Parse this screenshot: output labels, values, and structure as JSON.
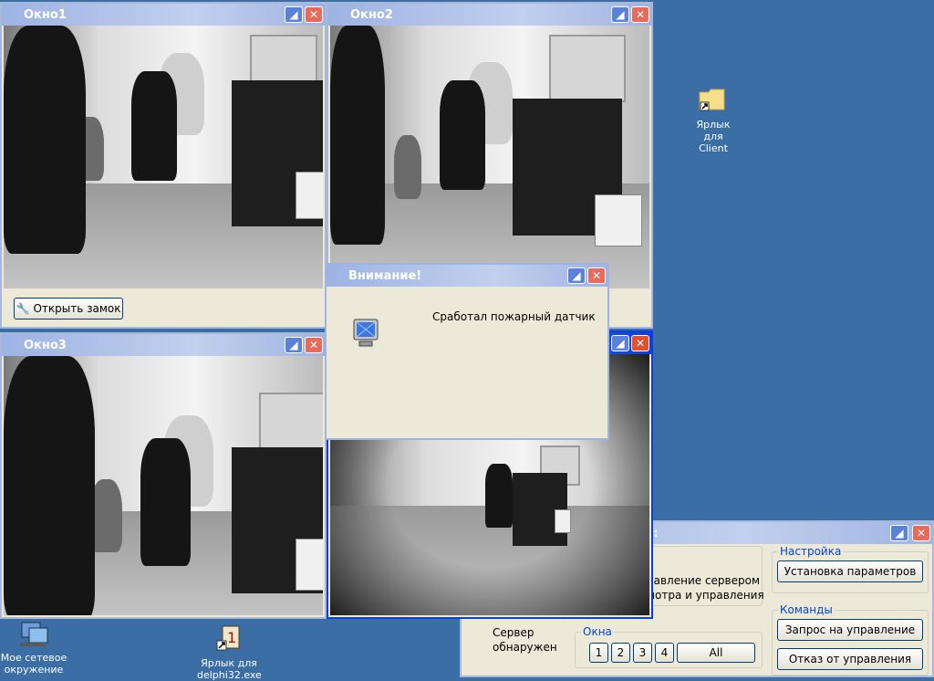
{
  "windows": {
    "okno1": {
      "title": "Окно1",
      "open_lock_label": "Открыть замок"
    },
    "okno2": {
      "title": "Окно2"
    },
    "okno3": {
      "title": "Окно3"
    },
    "okno4": {
      "title": ""
    }
  },
  "alert": {
    "title": "Внимание!",
    "message": "Сработал пожарный датчик"
  },
  "control": {
    "title_tail": ":::",
    "server_text_line1": "равление сервером",
    "server_text_line2": "мотра и управления",
    "server_status_line1": "Сервер",
    "server_status_line2": "обнаружен",
    "settings_group": "Настройка",
    "settings_button": "Установка параметров",
    "commands_group": "Команды",
    "request_button": "Запрос на управление",
    "release_button": "Отказ от управления",
    "windows_group": "Окна",
    "window_buttons": [
      "1",
      "2",
      "3",
      "4"
    ],
    "all_button": "All"
  },
  "desktop": {
    "client_shortcut_line1": "Ярлык для",
    "client_shortcut_line2": "Client",
    "network_line1": "Мое сетевое",
    "network_line2": "окружение",
    "delphi_line1": "Ярлык для",
    "delphi_line2": "delphi32.exe"
  },
  "colors": {
    "desktop": "#3a6ea5",
    "active_title": "#0a3fd8",
    "close_button": "#e86a5a"
  }
}
